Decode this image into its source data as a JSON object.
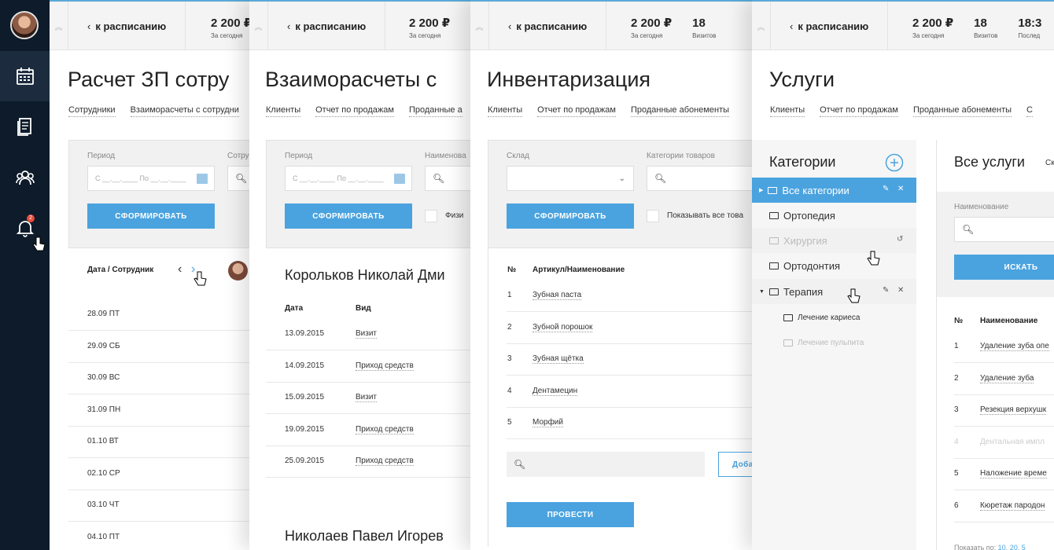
{
  "sidebar": {
    "icons": [
      "calendar-icon",
      "document-icon",
      "users-icon",
      "bell-icon"
    ],
    "notification_count": "2"
  },
  "topbar": {
    "back_label": "к расписанию",
    "stats": [
      {
        "value": "2 200 ₽",
        "label": "За сегодня"
      },
      {
        "value": "18",
        "label": "Визитов"
      },
      {
        "value": "18:3",
        "label": "Послед"
      }
    ]
  },
  "panel1": {
    "title": "Расчет ЗП сотру",
    "tabs": [
      "Сотрудники",
      "Взаиморасчеты с сотрудни"
    ],
    "filter": {
      "period_label": "Период",
      "period_placeholder": "С __.__.____  По __.__.____",
      "employee_label": "Сотру",
      "submit": "СФОРМИРОВАТЬ"
    },
    "table_header": "Дата / Сотрудник",
    "rows": [
      "28.09 ПТ",
      "29.09 СБ",
      "30.09 ВС",
      "31.09 ПН",
      "01.10 ВТ",
      "02.10 СР",
      "03.10 ЧТ",
      "04.10 ПТ"
    ]
  },
  "panel2": {
    "title": "Взаиморасчеты с",
    "tabs": [
      "Клиенты",
      "Отчет по продажам",
      "Проданные а"
    ],
    "filter": {
      "period_label": "Период",
      "period_placeholder": "С __.__.____  По __.__.____",
      "name_label": "Наименова",
      "submit": "СФОРМИРОВАТЬ",
      "checkbox_label": "Физи"
    },
    "person1": "Корольков Николай Дми",
    "col_date": "Дата",
    "col_type": "Вид",
    "rows": [
      {
        "date": "13.09.2015",
        "type": "Визит"
      },
      {
        "date": "14.09.2015",
        "type": "Приход средств"
      },
      {
        "date": "15.09.2015",
        "type": "Визит"
      },
      {
        "date": "19.09.2015",
        "type": "Приход средств"
      },
      {
        "date": "25.09.2015",
        "type": "Приход средств"
      }
    ],
    "person2": "Николаев Павел Игорев"
  },
  "panel3": {
    "title": "Инвентаризация",
    "tabs": [
      "Клиенты",
      "Отчет по продажам",
      "Проданные абонементы"
    ],
    "filter": {
      "warehouse_label": "Склад",
      "category_label": "Категории товаров",
      "submit": "СФОРМИРОВАТЬ",
      "checkbox_label": "Показывать все това"
    },
    "col_no": "№",
    "col_name": "Артикул/Наименование",
    "rows": [
      {
        "no": "1",
        "name": "Зубная паста"
      },
      {
        "no": "2",
        "name": "Зубной порошок"
      },
      {
        "no": "3",
        "name": "Зубная щётка"
      },
      {
        "no": "4",
        "name": "Дентамецин"
      },
      {
        "no": "5",
        "name": "Морфий"
      }
    ],
    "add_button": "Доба",
    "conduct_button": "ПРОВЕСТИ"
  },
  "panel4": {
    "title": "Услуги",
    "tabs": [
      "Клиенты",
      "Отчет по продажам",
      "Проданные абонементы",
      "С"
    ],
    "categories_title": "Категории",
    "categories": [
      {
        "label": "Все категории"
      },
      {
        "label": "Ортопедия"
      },
      {
        "label": "Хирургия"
      },
      {
        "label": "Ортодонтия"
      },
      {
        "label": "Терапия"
      },
      {
        "label": "Лечение кариеса"
      },
      {
        "label": "Лечение пульпита"
      }
    ],
    "services_title": "Все услуги",
    "services_sub": "Ск",
    "name_label": "Наименование",
    "search_button": "ИСКАТЬ",
    "col_no": "№",
    "col_name": "Наименование",
    "services": [
      {
        "no": "1",
        "name": "Удаление зуба опе"
      },
      {
        "no": "2",
        "name": "Удаление зуба"
      },
      {
        "no": "3",
        "name": "Резекция верхушк"
      },
      {
        "no": "4",
        "name": "Дентальная импл"
      },
      {
        "no": "5",
        "name": "Наложение време"
      },
      {
        "no": "6",
        "name": "Кюретаж пародон"
      }
    ],
    "show_by": "Показать по:",
    "page_sizes": [
      "10",
      "20",
      "5"
    ]
  },
  "colors": {
    "accent": "#4aa3df",
    "sidebar": "#0d1b2a"
  }
}
